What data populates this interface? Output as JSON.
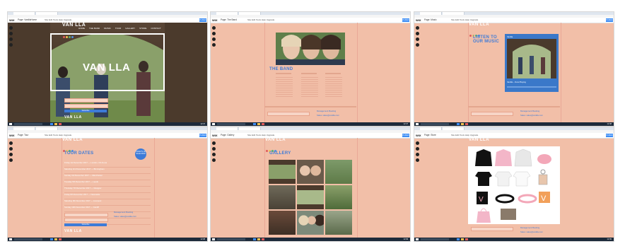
{
  "shots": [
    {
      "id": "home",
      "browser_tabs": [
        "Vanilla Home",
        "Vanilla Home"
      ],
      "editor": {
        "logo": "WiX",
        "page": "Page: VanillaHome",
        "menu": "Site  Edit  Tools  Help  Upgrade",
        "publish": "Publish"
      },
      "site": {
        "logo": "VAN LLA",
        "hero_title": "VAN LLA",
        "nav": [
          "HOME",
          "THE BAND",
          "MUSIC",
          "TOUR",
          "GALLERY",
          "STORE",
          "CONTACT"
        ]
      },
      "footer_logo": "VAN LLA",
      "form_button": "Subscribe",
      "taskbar_time": "12:47"
    },
    {
      "id": "band",
      "browser_tabs": [
        "Vanilla Home",
        "Vanilla Home"
      ],
      "editor": {
        "logo": "WiX",
        "page": "Page: The Band",
        "menu": "Site  Edit  Tools  Help  Upgrade",
        "publish": "Publish"
      },
      "site": {
        "heading": "THE BAND"
      },
      "footer_link_1": "Management Booking",
      "footer_link_2": "Sales: sales@vanilla.com",
      "taskbar_time": "12:47"
    },
    {
      "id": "music",
      "browser_tabs": [
        "Vanilla Home",
        "Vanilla Home"
      ],
      "editor": {
        "logo": "WiX",
        "page": "Page: Music",
        "menu": "Site  Edit  Tools  Help  Upgrade",
        "publish": "Publish"
      },
      "site": {
        "logo": "VAN LLA",
        "heading_line1": "LISTEN TO",
        "heading_line2": "OUR MUSIC",
        "player_title": "Vanilla",
        "player_track": "Vanilla – Now Playing"
      },
      "footer_link_1": "Management Booking",
      "footer_link_2": "Sales: sales@vanilla.com",
      "taskbar_time": "12:48"
    },
    {
      "id": "tour",
      "browser_tabs": [
        "Vanilla Home",
        "Vanilla Home"
      ],
      "editor": {
        "logo": "WiX",
        "page": "Page: Tour",
        "menu": "Site  Edit  Tools  Help  Upgrade",
        "publish": "Publish"
      },
      "site": {
        "logo": "VAN LLA",
        "heading": "TOUR DATES",
        "badge": "TICKETS ON SALE NOW",
        "dates": [
          "Friday 1st December 2017 — London, O2 Arena",
          "Saturday 2nd December 2017 — Birmingham",
          "Sunday 3rd December 2017 — Manchester",
          "Tuesday 5th December 2017 — Leeds",
          "Thursday 7th December 2017 — Glasgow",
          "Friday 8th December 2017 — Newcastle",
          "Saturday 9th December 2017 — Liverpool",
          "Sunday 10th December 2017 — Cardiff",
          "Tuesday 12th December 2017 — Bristol",
          "Wednesday 13th December 2017 — Brighton"
        ]
      },
      "form_button": "Subscribe",
      "footer_logo": "VAN LLA",
      "footer_link_1": "Management Booking",
      "footer_link_2": "Sales: sales@vanilla.com",
      "taskbar_time": "12:48"
    },
    {
      "id": "gallery",
      "browser_tabs": [
        "Vanilla Home",
        "Vanilla Home"
      ],
      "editor": {
        "logo": "WiX",
        "page": "Page: Gallery",
        "menu": "Site  Edit  Tools  Help  Upgrade",
        "publish": "Publish"
      },
      "site": {
        "logo": "VAN LLA",
        "heading": "GALLERY"
      },
      "taskbar_time": "12:49"
    },
    {
      "id": "store",
      "browser_tabs": [
        "Vanilla Home",
        "Vanilla Home"
      ],
      "editor": {
        "logo": "WiX",
        "page": "Page: Store",
        "menu": "Site  Edit  Tools  Help  Upgrade",
        "publish": "Publish"
      },
      "site": {
        "logo": "VAN LLA"
      },
      "footer_link_1": "Management Booking",
      "footer_link_2": "Sales: sales@vanilla.com",
      "taskbar_time": "12:49"
    }
  ],
  "colors": {
    "page_bg": "#f2bfa8",
    "accent_blue": "#3d7bd8",
    "taskbar": "#1d2a3a"
  }
}
